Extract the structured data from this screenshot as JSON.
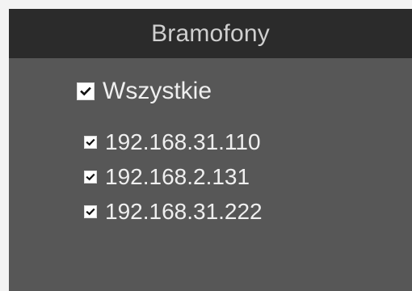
{
  "panel": {
    "title": "Bramofony",
    "select_all": {
      "label": "Wszystkie",
      "checked": true
    },
    "items": [
      {
        "label": "192.168.31.110",
        "checked": true
      },
      {
        "label": "192.168.2.131",
        "checked": true
      },
      {
        "label": "192.168.31.222",
        "checked": true
      }
    ]
  },
  "icons": {
    "checkmark": "checkmark-icon"
  },
  "colors": {
    "page_background": "#f3f3f3",
    "header_background": "#2b2b2b",
    "panel_background": "#575757",
    "header_text": "#cfcfcf",
    "row_text": "#efefef",
    "checkbox_fill": "#ffffff",
    "checkmark": "#111111"
  }
}
